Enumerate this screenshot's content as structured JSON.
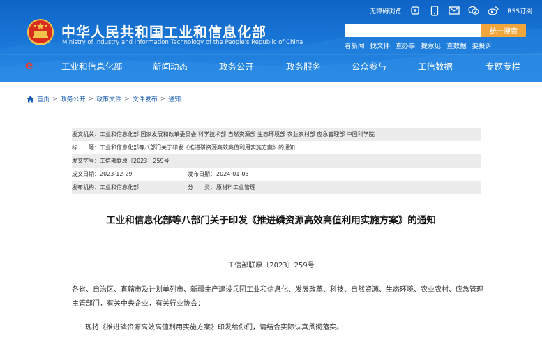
{
  "header": {
    "title_cn": "中华人民共和国工业和信息化部",
    "title_en": "Ministry of Industry and Information Technology of the People's Republic of China",
    "topbar": {
      "accessibility": "无障碍浏览",
      "rss": "RSS订阅"
    },
    "search": {
      "placeholder": "",
      "button": "统一搜索"
    },
    "quick_links": [
      "看新闻",
      "找文件",
      "查办事",
      "提意见",
      "查数据",
      "要投诉"
    ],
    "nav": [
      "工业和信息化部",
      "新闻动态",
      "政务公开",
      "政务服务",
      "公众参与",
      "工信数据",
      "专题专栏"
    ],
    "accent": "#1a78d8",
    "search_button_color": "#f0a63a"
  },
  "breadcrumb": [
    "首页",
    "政务公开",
    "政策文件",
    "文件发布",
    "通知"
  ],
  "info": {
    "issuer_label": "发文机关：",
    "issuer_value": "工业和信息化部 国家发展和改革委员会 科学技术部 自然资源部 生态环境部 农业农村部 应急管理部 中国科学院",
    "title_label": "标　　题：",
    "title_value": "工业和信息化部等八部门关于印发《推进磷资源高效高值利用实施方案》的通知",
    "docno_label": "发文字号：",
    "docno_value": "工信部联原〔2023〕259号",
    "date_label": "成文日期：",
    "date_value": "2023-12-29",
    "publish_label": "发布日期：",
    "publish_value": "2024-01-03",
    "org_label": "发布机构：",
    "org_value": "工业和信息化部",
    "category_label": "分　　类：",
    "category_value": "原材料工业管理"
  },
  "article": {
    "title": "工业和信息化部等八部门关于印发《推进磷资源高效高值利用实施方案》的通知",
    "doc_no": "工信部联原〔2023〕259号",
    "para1": "各省、自治区、直辖市及计划单列市、新疆生产建设兵团工业和信息化、发展改革、科技、自然资源、生态环境、农业农村、应急管理主管部门，有关中央企业，有关行业协会：",
    "para2": "现将《推进磷资源高效高值利用实施方案》印发给你们，请结合实际认真贯彻落实。"
  }
}
